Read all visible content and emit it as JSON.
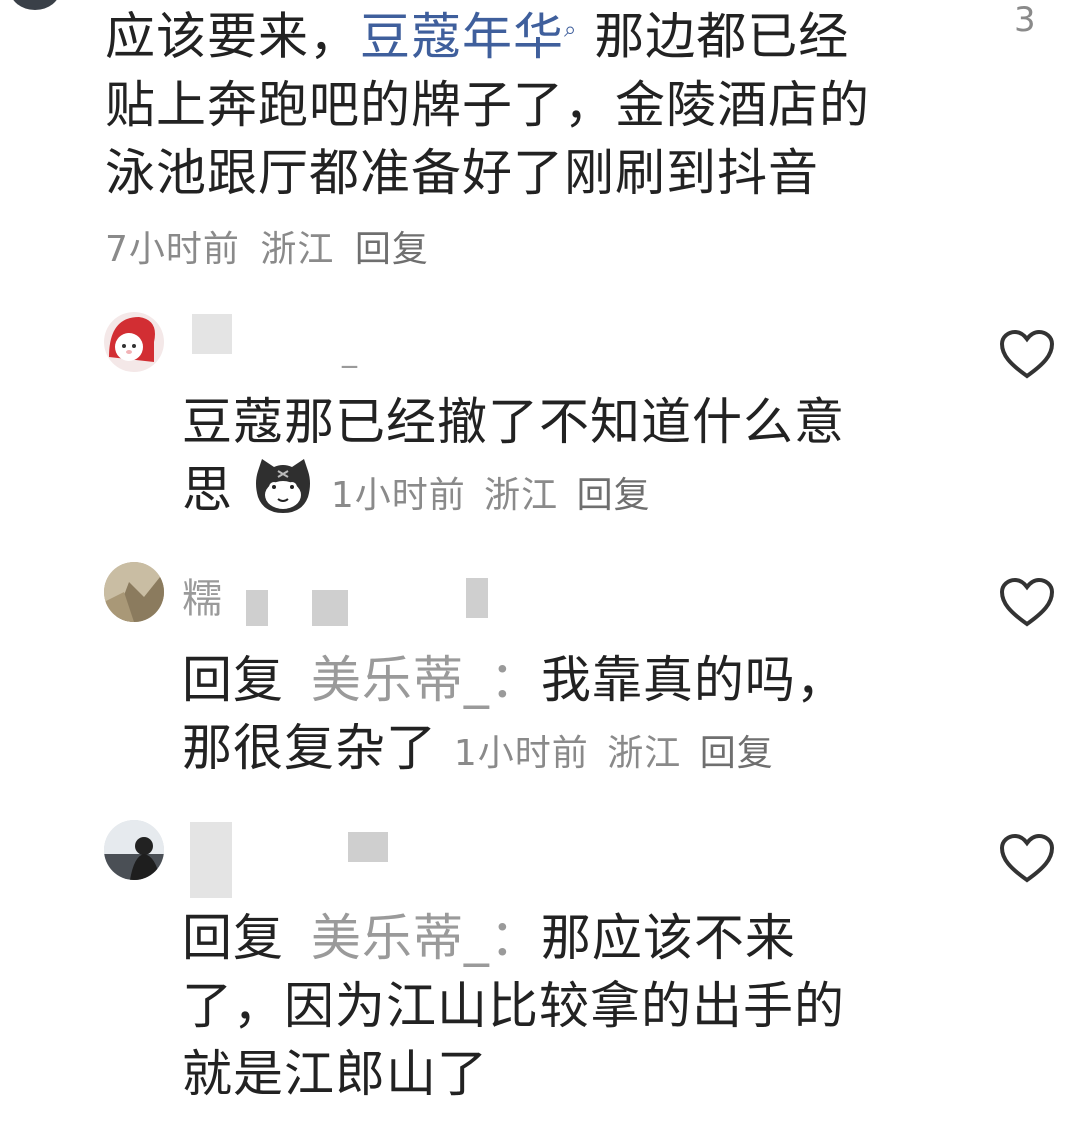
{
  "comments": [
    {
      "text_before": "应该要来，",
      "topic_link": "豆蔻年华",
      "text_line1_after": "那边都已经",
      "text_line2": "贴上奔跑吧的牌子了，金陵酒店的",
      "text_line3": "泳池跟厅都准备好了刚刷到抖音",
      "time": "7小时前",
      "location": "浙江",
      "reply": "回复",
      "likes": "3"
    },
    {
      "username_fragment": "_",
      "text_line1": "豆蔻那已经撤了不知道什么意",
      "text_line2": "思",
      "time": "1小时前",
      "location": "浙江",
      "reply": "回复"
    },
    {
      "username_fragment": "糯",
      "reply_prefix": "回复",
      "reply_to": "美乐蒂_：",
      "text_line1": "我靠真的吗，",
      "text_line2": "那很复杂了",
      "time": "1小时前",
      "location": "浙江",
      "reply": "回复"
    },
    {
      "username_fragment": "",
      "reply_prefix": "回复",
      "reply_to": "美乐蒂_：",
      "text_line1": "那应该不来",
      "text_line2": "了，因为江山比较拿的出手的",
      "text_line3": "就是江郎山了"
    }
  ],
  "icons": {
    "like": "heart-outline-icon",
    "search": "search-icon",
    "emoji": "cat-emoji-icon"
  }
}
